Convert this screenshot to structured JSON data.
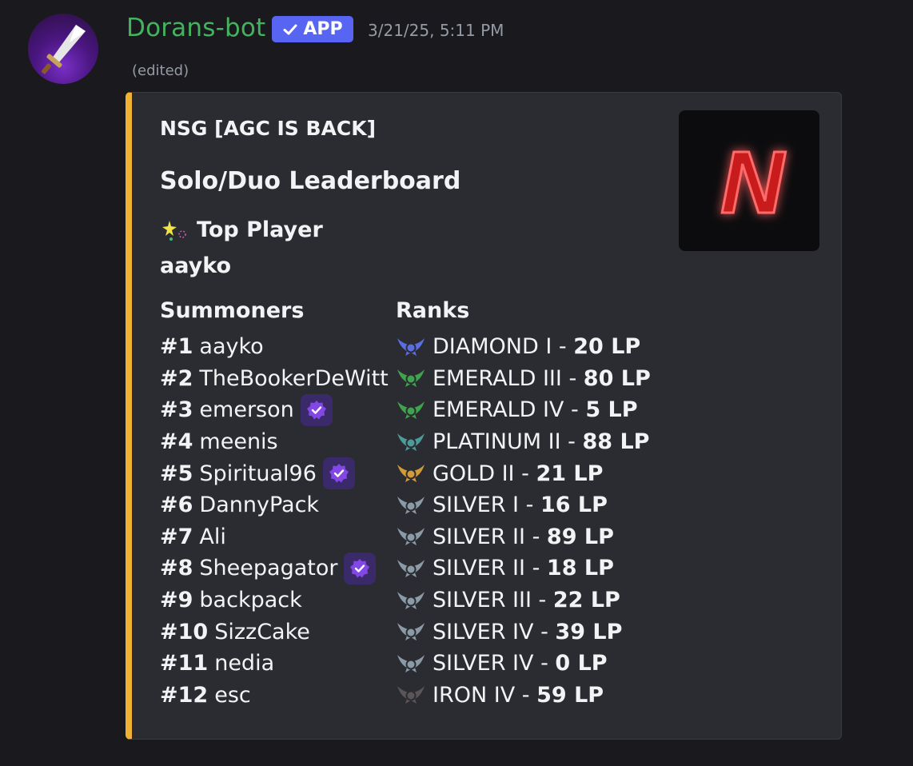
{
  "message": {
    "username": "Dorans-bot",
    "badge": "APP",
    "timestamp": "3/21/25, 5:11 PM",
    "edited": "(edited)"
  },
  "embed": {
    "accent_color": "#f0b232",
    "author": "NSG [AGC IS BACK]",
    "title": "Solo/Duo Leaderboard",
    "top_player_label": "Top Player",
    "top_player_name": "aayko",
    "columns": {
      "summoners": "Summoners",
      "ranks": "Ranks"
    },
    "thumbnail_letter": "N",
    "summoners": [
      {
        "pos": "#1",
        "name": "aayko",
        "verified": false
      },
      {
        "pos": "#2",
        "name": "TheBookerDeWitt",
        "verified": false
      },
      {
        "pos": "#3",
        "name": "emerson",
        "verified": true
      },
      {
        "pos": "#4",
        "name": "meenis",
        "verified": false
      },
      {
        "pos": "#5",
        "name": "Spiritual96",
        "verified": true
      },
      {
        "pos": "#6",
        "name": "DannyPack",
        "verified": false
      },
      {
        "pos": "#7",
        "name": "Ali",
        "verified": false
      },
      {
        "pos": "#8",
        "name": "Sheepagator",
        "verified": true
      },
      {
        "pos": "#9",
        "name": "backpack",
        "verified": false
      },
      {
        "pos": "#10",
        "name": "SizzCake",
        "verified": false
      },
      {
        "pos": "#11",
        "name": "nedia",
        "verified": false
      },
      {
        "pos": "#12",
        "name": "esc",
        "verified": false
      }
    ],
    "ranks": [
      {
        "tier": "DIAMOND I",
        "lp": "20 LP",
        "icon": "diamond-rank-icon",
        "color": "#5b6ee1"
      },
      {
        "tier": "EMERALD III",
        "lp": "80 LP",
        "icon": "emerald-rank-icon",
        "color": "#3fa34d"
      },
      {
        "tier": "EMERALD IV",
        "lp": "5 LP",
        "icon": "emerald-rank-icon",
        "color": "#3fa34d"
      },
      {
        "tier": "PLATINUM II",
        "lp": "88 LP",
        "icon": "platinum-rank-icon",
        "color": "#4e9a99"
      },
      {
        "tier": "GOLD II",
        "lp": "21 LP",
        "icon": "gold-rank-icon",
        "color": "#d39a3a"
      },
      {
        "tier": "SILVER I",
        "lp": "16 LP",
        "icon": "silver-rank-icon",
        "color": "#8a9aa6"
      },
      {
        "tier": "SILVER II",
        "lp": "89 LP",
        "icon": "silver-rank-icon",
        "color": "#8a9aa6"
      },
      {
        "tier": "SILVER II",
        "lp": "18 LP",
        "icon": "silver-rank-icon",
        "color": "#8a9aa6"
      },
      {
        "tier": "SILVER III",
        "lp": "22 LP",
        "icon": "silver-rank-icon",
        "color": "#8a9aa6"
      },
      {
        "tier": "SILVER IV",
        "lp": "39 LP",
        "icon": "silver-rank-icon",
        "color": "#8a9aa6"
      },
      {
        "tier": "SILVER IV",
        "lp": "0 LP",
        "icon": "silver-rank-icon",
        "color": "#8a9aa6"
      },
      {
        "tier": "IRON IV",
        "lp": "59 LP",
        "icon": "iron-rank-icon",
        "color": "#5a5556"
      }
    ]
  }
}
